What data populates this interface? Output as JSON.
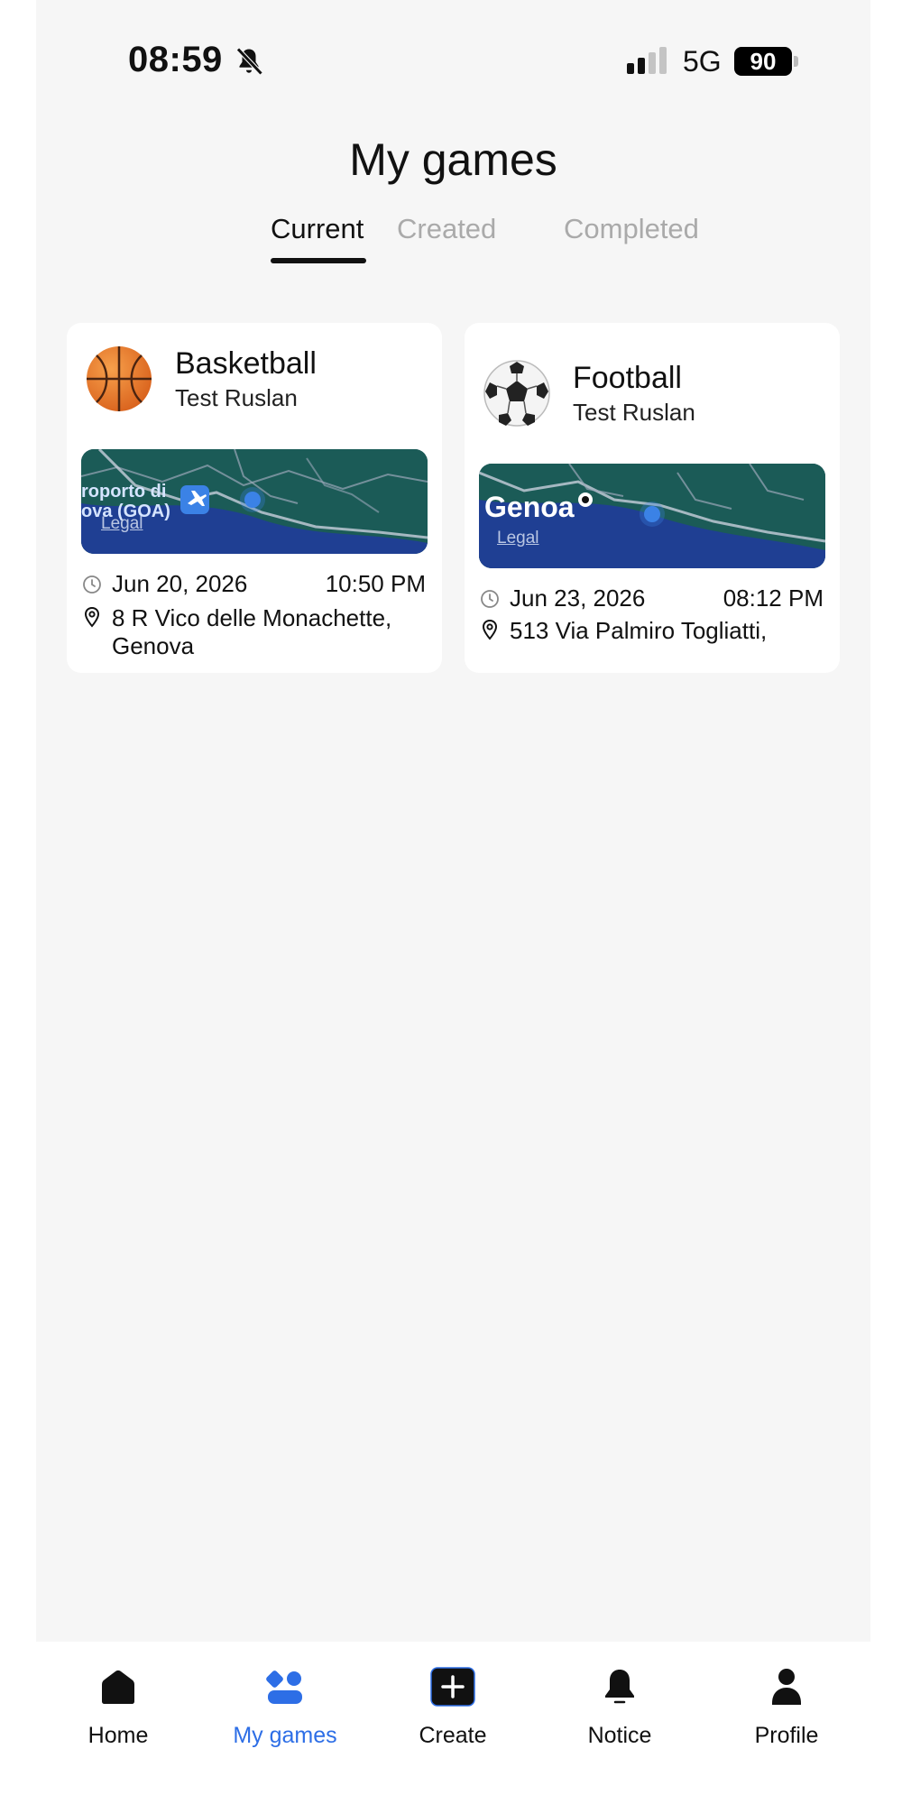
{
  "status_bar": {
    "time": "08:59",
    "network": "5G",
    "battery": "90"
  },
  "header": {
    "title": "My games"
  },
  "tabs": [
    {
      "label": "Current",
      "active": true
    },
    {
      "label": "Created",
      "active": false
    },
    {
      "label": "Completed",
      "active": false
    }
  ],
  "games": [
    {
      "sport": "Basketball",
      "organizer": "Test Ruslan",
      "icon": "basketball-icon",
      "map_labels": [
        "roporto di",
        "ova (GOA)"
      ],
      "map_legal": "Legal",
      "date": "Jun 20, 2026",
      "time": "10:50 PM",
      "address": "8 R Vico delle Monachette, Genova"
    },
    {
      "sport": "Football",
      "organizer": "Test Ruslan",
      "icon": "soccer-ball-icon",
      "map_labels": [
        "Genoa"
      ],
      "map_legal": "Legal",
      "date": "Jun 23, 2026",
      "time": "08:12 PM",
      "address": "513 Via Palmiro Togliatti,"
    }
  ],
  "tabbar": {
    "items": [
      {
        "label": "Home",
        "icon": "home-icon",
        "active": false
      },
      {
        "label": "My games",
        "icon": "my-games-icon",
        "active": true
      },
      {
        "label": "Create",
        "icon": "plus-icon",
        "active": false
      },
      {
        "label": "Notice",
        "icon": "bell-icon",
        "active": false
      },
      {
        "label": "Profile",
        "icon": "person-icon",
        "active": false
      }
    ]
  },
  "colors": {
    "accent": "#2d6ee6",
    "background": "#f6f6f6",
    "map_land": "#1c5a58",
    "map_sea": "#1d3a8c"
  }
}
